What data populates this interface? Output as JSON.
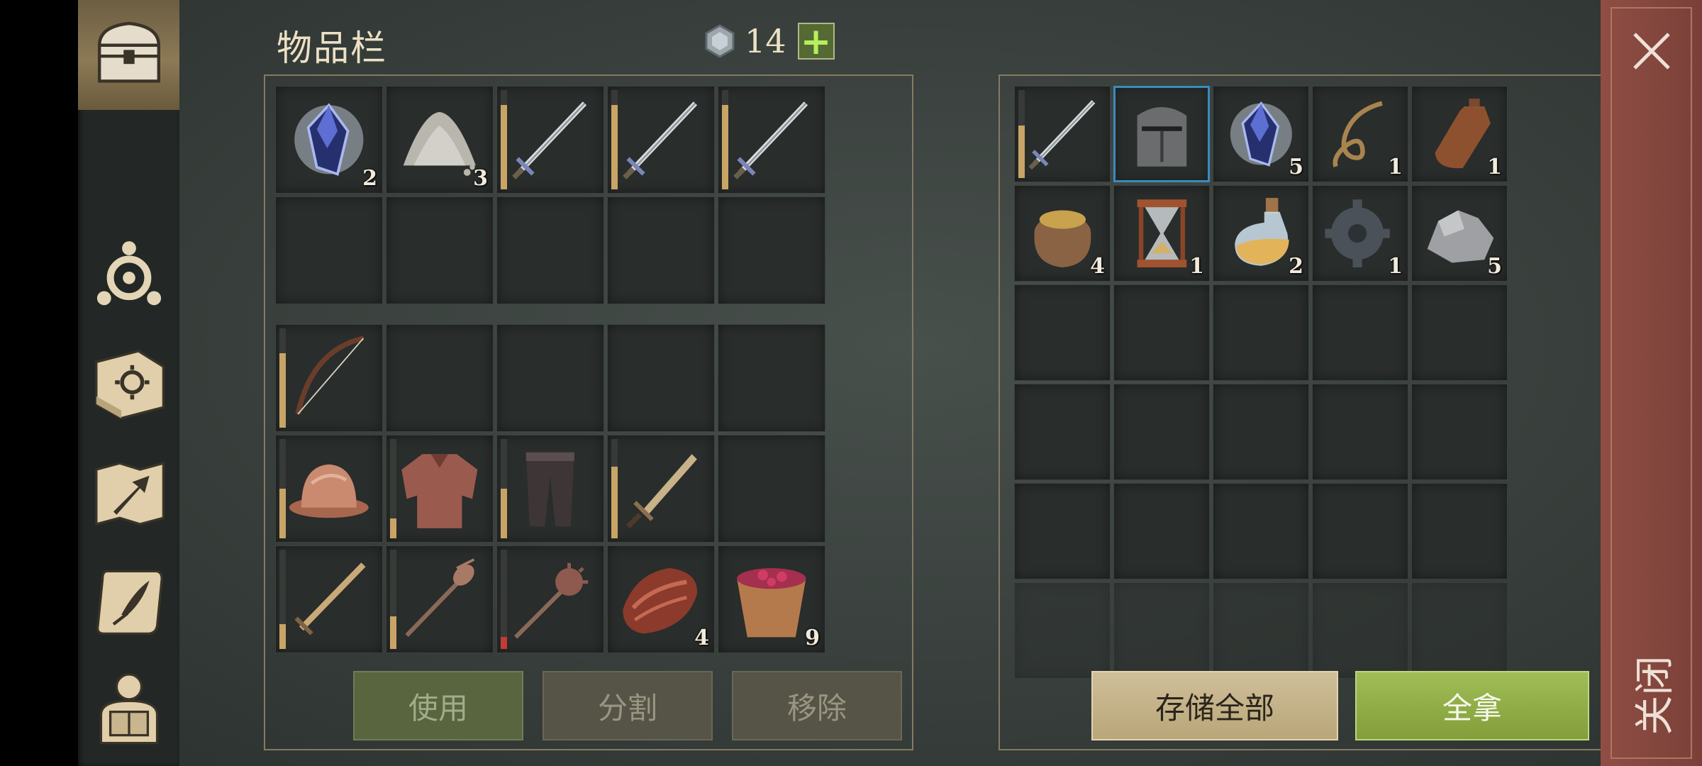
{
  "inventory": {
    "title": "物品栏",
    "currency_amount": "14",
    "currency_plus": "+",
    "pockets": [
      {
        "icon": "crystal-shard-icon",
        "qty": "2"
      },
      {
        "icon": "stone-dust-pile-icon",
        "qty": "3"
      },
      {
        "icon": "longsword-icon",
        "qty": "",
        "durability": 0.85
      },
      {
        "icon": "longsword-icon",
        "qty": "",
        "durability": 0.85
      },
      {
        "icon": "longsword-icon",
        "qty": "",
        "durability": 0.85
      },
      {
        "icon": "",
        "qty": ""
      },
      {
        "icon": "",
        "qty": ""
      },
      {
        "icon": "",
        "qty": ""
      },
      {
        "icon": "",
        "qty": ""
      },
      {
        "icon": "",
        "qty": ""
      }
    ],
    "equipment": [
      {
        "icon": "bow-icon",
        "qty": "",
        "durability": 0.75
      },
      {
        "icon": "",
        "qty": ""
      },
      {
        "icon": "",
        "qty": ""
      },
      {
        "icon": "",
        "qty": ""
      },
      {
        "icon": "",
        "qty": ""
      },
      {
        "icon": "kettle-helmet-icon",
        "qty": "",
        "durability": 0.5
      },
      {
        "icon": "chainmail-shirt-icon",
        "qty": "",
        "durability": 0.2
      },
      {
        "icon": "leather-pants-icon",
        "qty": "",
        "durability": 0.5
      },
      {
        "icon": "short-sword-icon",
        "qty": "",
        "durability": 0.72
      },
      {
        "icon": "",
        "qty": ""
      },
      {
        "icon": "wooden-sword-icon",
        "qty": "",
        "durability": 0.25
      },
      {
        "icon": "spiked-mace-icon",
        "qty": "",
        "durability": 0.33
      },
      {
        "icon": "morning-star-icon",
        "qty": "",
        "durability": 0.12,
        "low": true
      },
      {
        "icon": "raw-meat-icon",
        "qty": "4"
      },
      {
        "icon": "berry-bucket-icon",
        "qty": "9"
      }
    ],
    "buttons": {
      "use": "使用",
      "split": "分割",
      "remove": "移除"
    }
  },
  "container": {
    "slots": [
      {
        "icon": "longsword-icon",
        "qty": "",
        "durability": 0.6
      },
      {
        "icon": "great-helm-icon",
        "qty": "",
        "selected": true
      },
      {
        "icon": "crystal-shard-icon",
        "qty": "5"
      },
      {
        "icon": "rope-icon",
        "qty": "1"
      },
      {
        "icon": "leather-flask-icon",
        "qty": "1"
      },
      {
        "icon": "grain-sack-icon",
        "qty": "4"
      },
      {
        "icon": "hourglass-icon",
        "qty": "1"
      },
      {
        "icon": "potion-flask-icon",
        "qty": "2"
      },
      {
        "icon": "iron-gear-icon",
        "qty": "1"
      },
      {
        "icon": "stone-ore-icon",
        "qty": "5"
      }
    ],
    "total_slots": 30,
    "buttons": {
      "store_all": "存储全部",
      "take_all": "全拿"
    }
  },
  "sidebar": {
    "items": [
      {
        "icon": "chest-icon",
        "active": true
      },
      {
        "icon": "skills-icon"
      },
      {
        "icon": "recipe-book-icon"
      },
      {
        "icon": "map-icon"
      },
      {
        "icon": "quest-scroll-icon"
      },
      {
        "icon": "character-icon"
      }
    ]
  },
  "close": {
    "label": "关闭"
  },
  "colors": {
    "background": "#3b423f",
    "slot": "#292d2b",
    "frame": "#857a62",
    "durability": "#c8a466",
    "durability_low": "#c23b36",
    "take_all": "#8fab45",
    "store_all": "#c4b38a",
    "close_panel": "#8a4a40",
    "selected_border": "#3a8bbd"
  }
}
